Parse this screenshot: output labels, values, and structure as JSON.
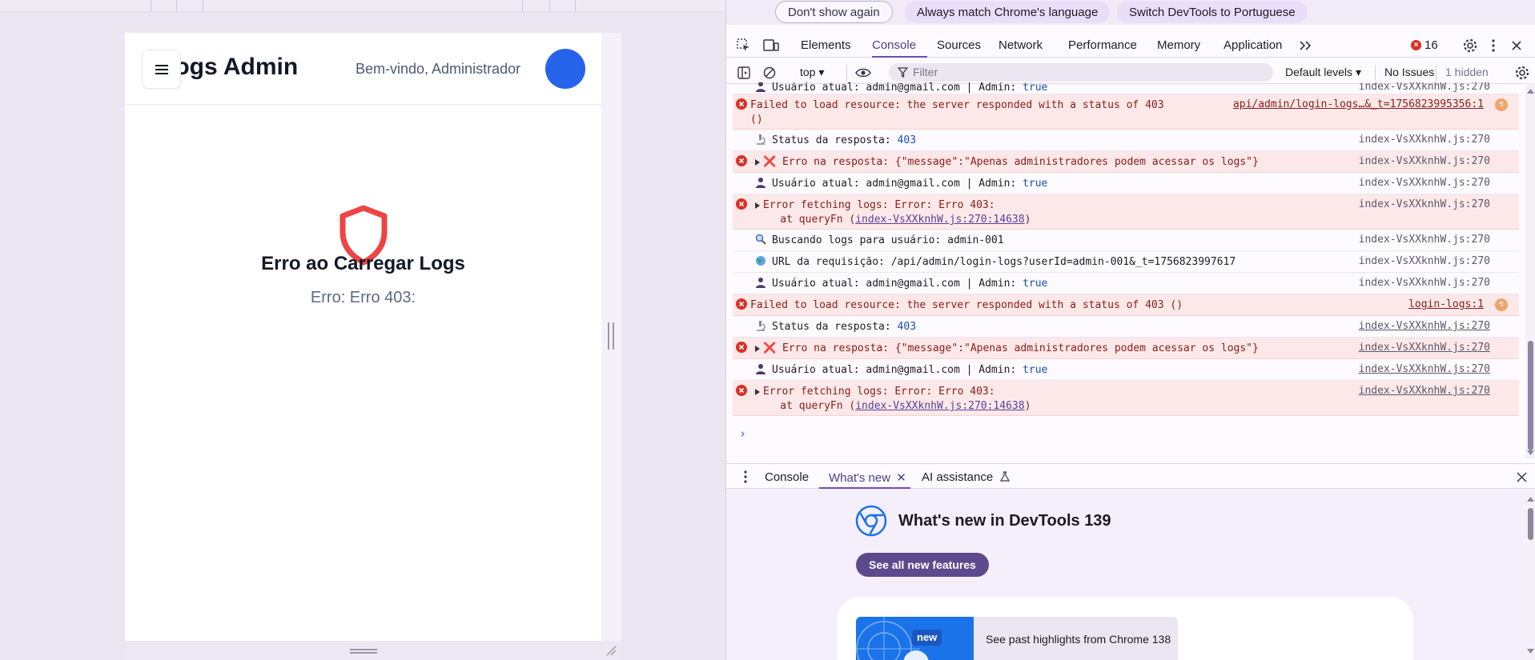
{
  "app": {
    "title": "Logs Admin",
    "welcome": "Bem-vindo, Administrador",
    "error_title": "Erro ao Carregar Logs",
    "error_message": "Erro: Erro 403:"
  },
  "infobar": {
    "dont_show": "Don't show again",
    "always_match": "Always match Chrome's language",
    "switch_lang": "Switch DevTools to Portuguese"
  },
  "devtools": {
    "tabs": [
      "Elements",
      "Console",
      "Sources",
      "Network",
      "Performance",
      "Memory",
      "Application"
    ],
    "active_tab": "Console",
    "error_count": "16",
    "context": "top",
    "filter_placeholder": "Filter",
    "levels": "Default levels",
    "issues": "No Issues",
    "hidden": "1 hidden",
    "colors": {
      "accent": "#6b4eb8",
      "error_bg": "#fce8e8",
      "error": "#d93025"
    }
  },
  "console": {
    "rows": [
      {
        "type": "log",
        "icon": "user-icon",
        "text": "Usuário atual: admin@gmail.com | Admin: ",
        "value": "true",
        "source": "index-VsXXknhW.js:270"
      },
      {
        "type": "error",
        "icon": "error-icon",
        "text": "Failed to load resource: the server responded with a status of 403",
        "text2": "()",
        "source": "api/admin/login-logs…&_t=1756823995356:1",
        "badge": true
      },
      {
        "type": "log",
        "icon": "microscope-icon",
        "text": "Status da resposta: ",
        "value": "403",
        "source": "index-VsXXknhW.js:270"
      },
      {
        "type": "error",
        "icon": "error-icon",
        "text": "❌ Erro na resposta: {\"message\":\"Apenas administradores podem acessar os logs\"}",
        "expand": true,
        "source": "index-VsXXknhW.js:270"
      },
      {
        "type": "log",
        "icon": "user-icon",
        "text": "Usuário atual: admin@gmail.com | Admin: ",
        "value": "true",
        "source": "index-VsXXknhW.js:270"
      },
      {
        "type": "error",
        "icon": "error-icon",
        "text": "Error fetching logs: Error: Erro 403:",
        "text2": "    at queryFn (",
        "link2": "index-VsXXknhW.js:270:14638",
        "tail2": ")",
        "expand": true,
        "source": "index-VsXXknhW.js:270"
      },
      {
        "type": "log",
        "icon": "search-icon",
        "text": "Buscando logs para usuário: admin-001",
        "source": "index-VsXXknhW.js:270"
      },
      {
        "type": "log",
        "icon": "globe-icon",
        "text": "URL da requisição: /api/admin/login-logs?userId=admin-001&_t=1756823997617",
        "source": "index-VsXXknhW.js:270"
      },
      {
        "type": "log",
        "icon": "user-icon",
        "text": "Usuário atual: admin@gmail.com | Admin: ",
        "value": "true",
        "source": "index-VsXXknhW.js:270"
      },
      {
        "type": "error",
        "icon": "error-icon",
        "text": "Failed to load resource: the server responded with a status of 403 ()",
        "source": "login-logs:1",
        "badge": true
      },
      {
        "type": "log",
        "icon": "microscope-icon",
        "text": "Status da resposta: ",
        "value": "403",
        "source": "index-VsXXknhW.js:270",
        "link_source": true
      },
      {
        "type": "error",
        "icon": "error-icon",
        "text": "❌ Erro na resposta: {\"message\":\"Apenas administradores podem acessar os logs\"}",
        "expand": true,
        "source": "index-VsXXknhW.js:270",
        "link_source": true
      },
      {
        "type": "log",
        "icon": "user-icon",
        "text": "Usuário atual: admin@gmail.com | Admin: ",
        "value": "true",
        "source": "index-VsXXknhW.js:270",
        "link_source": true
      },
      {
        "type": "error",
        "icon": "error-icon",
        "text": "Error fetching logs: Error: Erro 403:",
        "text2": "    at queryFn (",
        "link2": "index-VsXXknhW.js:270:14638",
        "tail2": ")",
        "expand": true,
        "source": "index-VsXXknhW.js:270",
        "link_source": true
      }
    ]
  },
  "drawer": {
    "tabs": [
      "Console",
      "What's new",
      "AI assistance"
    ],
    "active_tab": "What's new",
    "whatsnew_title": "What's new in DevTools 139",
    "see_all": "See all new features",
    "new_badge": "new",
    "highlights": "See past highlights from Chrome 138"
  }
}
